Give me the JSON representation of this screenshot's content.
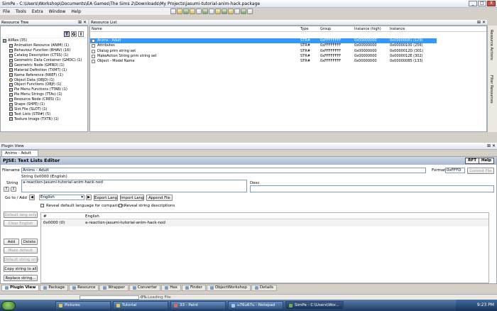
{
  "window": {
    "title": "SimPe - C:\\Users\\Workshop\\Documents\\EA Games\\The Sims 2\\Downloads\\My Projects\\jasumi-tutorial-anim-hack.package",
    "controls": [
      "_",
      "□",
      "X"
    ]
  },
  "menu": [
    "File",
    "Tools",
    "Extra",
    "Window",
    "Help"
  ],
  "tree": {
    "header": "Resource Tree",
    "pin": "⊞ ✕",
    "toggles": [
      "T",
      "G",
      "I"
    ],
    "root": "AllRes (35)",
    "items": [
      {
        "label": "Animation Resource (ANIM) (1)",
        "icon": "file-icon"
      },
      {
        "label": "Behaviour Function (BHAV) (16)",
        "icon": "file-icon"
      },
      {
        "label": "Catalog Description (CTSS) (1)",
        "icon": "file-icon"
      },
      {
        "label": "Geometric Data Container (GMDC) (1)",
        "icon": "file-icon"
      },
      {
        "label": "Geometric Node (GMND) (1)",
        "icon": "file-icon"
      },
      {
        "label": "Material Definition (TXMT) (1)",
        "icon": "file-icon"
      },
      {
        "label": "Name Reference (NREF) (1)",
        "icon": "file-icon"
      },
      {
        "label": "Object Data (OBJD) (1)",
        "icon": "object-icon"
      },
      {
        "label": "Object Functions (OBJf) (1)",
        "icon": "file-icon"
      },
      {
        "label": "Pie Menu Functions (TTAB) (1)",
        "icon": "file-icon"
      },
      {
        "label": "Pie Menu Strings (TTAs) (1)",
        "icon": "file-icon"
      },
      {
        "label": "Resource Node (CRES) (1)",
        "icon": "file-icon"
      },
      {
        "label": "Shape (SHPE) (1)",
        "icon": "file-icon"
      },
      {
        "label": "Slot File (SLOT) (1)",
        "icon": "file-icon"
      },
      {
        "label": "Text Lists (STR#) (5)",
        "icon": "file-icon"
      },
      {
        "label": "Texture Image (TXTR) (1)",
        "icon": "file-icon"
      }
    ]
  },
  "list": {
    "header": "Resource List",
    "pin": "⊞ ✕",
    "columns": [
      "Name",
      "Type",
      "Group",
      "Instance (high)",
      "Instance"
    ],
    "rows": [
      [
        "Anims - Adult",
        "STR#",
        "0xFFFFFFFF",
        "0x00000000",
        "0x00000081 (129)"
      ],
      [
        "Attributes",
        "STR#",
        "0xFFFFFFFF",
        "0x00000000",
        "0x00000100 (256)"
      ],
      [
        "Dialog prim string set",
        "STR#",
        "0xFFFFFFFF",
        "0x00000000",
        "0x0000012D (301)"
      ],
      [
        "MakeAction String prim string set",
        "STR#",
        "0xFFFFFFFF",
        "0x00000000",
        "0x0000012E (302)"
      ],
      [
        "Object - Model Name",
        "STR#",
        "0xFFFFFFFF",
        "0x00000000",
        "0x00000085 (133)"
      ]
    ]
  },
  "side_tabs": [
    "Resource Actions",
    "Filter Resources"
  ],
  "plugin": {
    "header": "Plugin View",
    "doc_tab": "Anims - Adult",
    "pin": "⊞ ✕",
    "title": "PJSE: Text Lists Editor",
    "rft": "RFT",
    "help": "Help",
    "filename_label": "Filename",
    "filename": "Anims - Adult",
    "format_label": "Format",
    "format": "0xFFFD",
    "commit": "Commit File",
    "string_label": "String",
    "string_header": "String 0x0000 (English)",
    "string_value": "a-reaction-jasumi-tutorial-anim-hack-nod",
    "desc_label": "Desc",
    "goto_label": "Go to / Add",
    "language": "English",
    "export_lang": "Export Lang",
    "import_lang": "Import Lang",
    "append_file": "Append File",
    "reveal_default": "Reveal default language for comparison",
    "reveal_desc": "Reveal string descriptions",
    "side_buttons": [
      {
        "label": "Default lang only",
        "disabled": true
      },
      {
        "label": "Clear English",
        "disabled": true
      }
    ],
    "add": "Add",
    "delete": "Delete",
    "side_buttons2": [
      {
        "label": "Make default",
        "disabled": true
      },
      {
        "label": "Default string only",
        "disabled": true
      },
      {
        "label": "Copy string to all",
        "disabled": false
      },
      {
        "label": "Replace string...",
        "disabled": false
      }
    ],
    "grid": {
      "columns": [
        "#",
        "English"
      ],
      "rows": [
        [
          "0x0000 (0)",
          "a-reaction-jasumi-tutorial-anim-hack-nod"
        ]
      ]
    }
  },
  "bottom_tabs": [
    "Plugin View",
    "Package",
    "Resource",
    "Wrapper",
    "Converter",
    "Hex",
    "Finder",
    "ObjectWorkshop",
    "Details"
  ],
  "status": {
    "zoom": "0%",
    "text": "Loading File"
  },
  "taskbar": {
    "items": [
      "Pictures",
      "Tutorial",
      "33 - Paint",
      "u76u67u - Notepad",
      "SimPe - C:\\Users\\Wor..."
    ],
    "active": 4,
    "clock": "9:23 PM"
  }
}
